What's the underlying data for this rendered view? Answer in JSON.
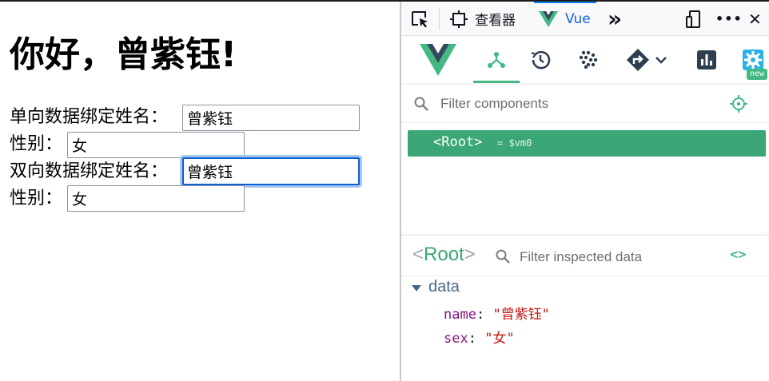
{
  "page": {
    "heading": "你好，曾紫钰!",
    "one_way_label": "单向数据绑定姓名：",
    "one_way_name": "曾紫钰",
    "sex_label_1": "性别：",
    "sex_value_1": "女",
    "two_way_label": "双向数据绑定姓名：",
    "two_way_name": "曾紫钰",
    "sex_label_2": "性别：",
    "sex_value_2": "女"
  },
  "devtools": {
    "toolbar": {
      "inspector_label": "查看器",
      "vue_tab_label": "Vue",
      "overflow_label": "»",
      "menu_label": "•••",
      "close_label": "✕"
    },
    "vue_nav": {
      "icons": [
        "vue-logo-icon",
        "components-tree-icon",
        "timeline-icon",
        "performance-icon",
        "routing-icon",
        "chevron-down-icon",
        "chart-icon",
        "settings-icon"
      ],
      "new_badge": "new"
    },
    "components": {
      "filter_placeholder": "Filter components",
      "root_tag": "<Root>",
      "root_ref": "= $vm0"
    },
    "inspector": {
      "root_open": "<",
      "root_name": "Root",
      "root_close": ">",
      "filter_placeholder": "Filter inspected data",
      "code_label": "<>",
      "section": "data",
      "props": [
        {
          "key": "name",
          "value": "\"曾紫钰\""
        },
        {
          "key": "sex",
          "value": "\"女\""
        }
      ]
    },
    "colors": {
      "vue_green": "#42b883",
      "selected_row": "#3ba776",
      "key": "#881280",
      "string": "#c41a16"
    }
  }
}
